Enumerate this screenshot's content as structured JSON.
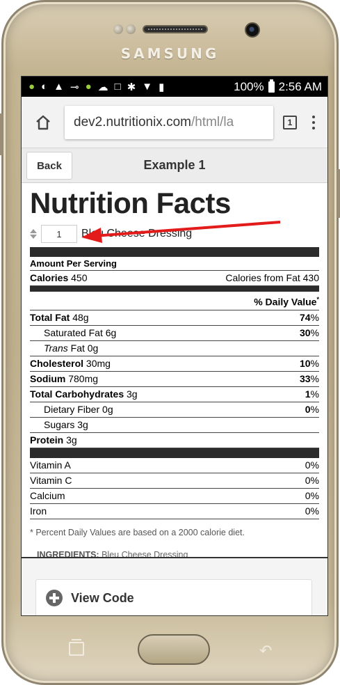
{
  "device": {
    "brand": "SAMSUNG"
  },
  "status": {
    "battery": "100%",
    "time": "2:56 AM"
  },
  "browser": {
    "url_host": "dev2.nutritionix.com",
    "url_path": "/html/la",
    "tab_count": "1"
  },
  "header": {
    "back_label": "Back",
    "title": "Example 1"
  },
  "label": {
    "title": "Nutrition Facts",
    "serving_qty": "1",
    "food_name": "Bleu Cheese Dressing",
    "amount_per_serving": "Amount Per Serving",
    "calories_label": "Calories",
    "calories_value": "450",
    "calories_from_fat": "Calories from Fat 430",
    "daily_value_head": "% Daily Value",
    "rows": [
      {
        "name": "Total Fat",
        "amount": "48g",
        "dv": "74",
        "bold_name": true,
        "indent": false
      },
      {
        "name": "Saturated Fat",
        "amount": "6g",
        "dv": "30",
        "bold_name": false,
        "indent": true
      },
      {
        "name": "Trans",
        "name_suffix": "Fat",
        "amount": "0g",
        "dv": "",
        "bold_name": false,
        "indent": true,
        "italic": true
      },
      {
        "name": "Cholesterol",
        "amount": "30mg",
        "dv": "10",
        "bold_name": true,
        "indent": false
      },
      {
        "name": "Sodium",
        "amount": "780mg",
        "dv": "33",
        "bold_name": true,
        "indent": false
      },
      {
        "name": "Total Carbohydrates",
        "amount": "3g",
        "dv": "1",
        "bold_name": true,
        "indent": false
      },
      {
        "name": "Dietary Fiber",
        "amount": "0g",
        "dv": "0",
        "bold_name": false,
        "indent": true
      },
      {
        "name": "Sugars",
        "amount": "3g",
        "dv": "",
        "bold_name": false,
        "indent": true
      },
      {
        "name": "Protein",
        "amount": "3g",
        "dv": "",
        "bold_name": true,
        "indent": false
      }
    ],
    "vitamins": [
      {
        "name": "Vitamin A",
        "dv": "0%"
      },
      {
        "name": "Vitamin C",
        "dv": "0%"
      },
      {
        "name": "Calcium",
        "dv": "0%"
      },
      {
        "name": "Iron",
        "dv": "0%"
      }
    ],
    "footnote": "* Percent Daily Values are based on a 2000 calorie diet.",
    "ingredients_label": "INGREDIENTS:",
    "ingredients_value": "Bleu Cheese Dressing"
  },
  "code": {
    "view_code_label": "View Code"
  },
  "colors": {
    "arrow": "#e31b1b",
    "android_green": "#9ccc3c"
  }
}
